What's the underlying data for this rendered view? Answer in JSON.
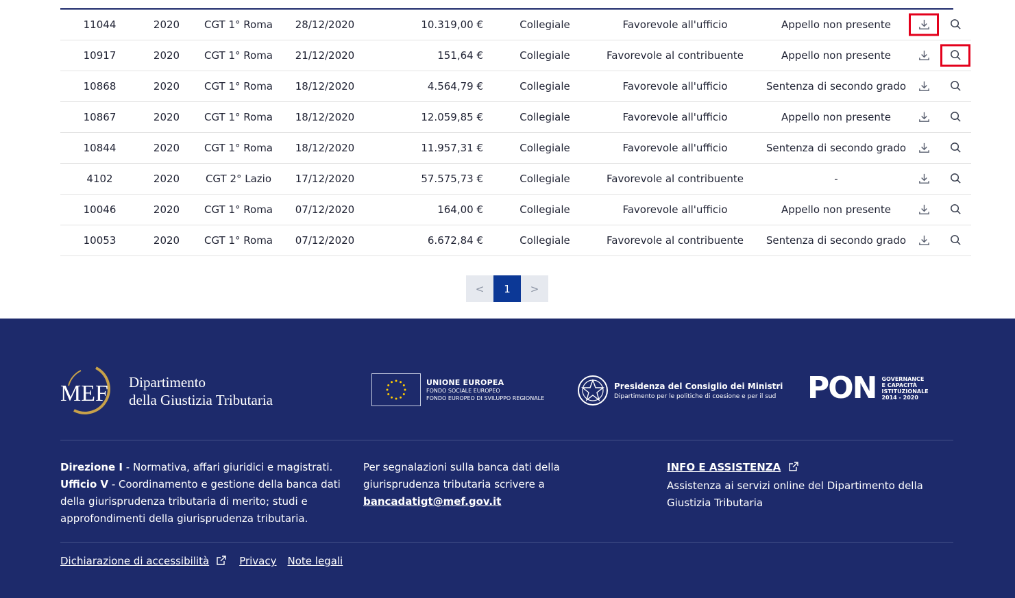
{
  "columns_count": 9,
  "rows": [
    {
      "numero": "11044",
      "anno": "2020",
      "commissione": "CGT 1° Roma",
      "data": "28/12/2020",
      "valore": "10.319,00 €",
      "composizione": "Collegiale",
      "esito": "Favorevole all'ufficio",
      "appello": "Appello non presente"
    },
    {
      "numero": "10917",
      "anno": "2020",
      "commissione": "CGT 1° Roma",
      "data": "21/12/2020",
      "valore": "151,64 €",
      "composizione": "Collegiale",
      "esito": "Favorevole al contribuente",
      "appello": "Appello non presente"
    },
    {
      "numero": "10868",
      "anno": "2020",
      "commissione": "CGT 1° Roma",
      "data": "18/12/2020",
      "valore": "4.564,79 €",
      "composizione": "Collegiale",
      "esito": "Favorevole all'ufficio",
      "appello": "Sentenza di secondo grado"
    },
    {
      "numero": "10867",
      "anno": "2020",
      "commissione": "CGT 1° Roma",
      "data": "18/12/2020",
      "valore": "12.059,85 €",
      "composizione": "Collegiale",
      "esito": "Favorevole all'ufficio",
      "appello": "Appello non presente"
    },
    {
      "numero": "10844",
      "anno": "2020",
      "commissione": "CGT 1° Roma",
      "data": "18/12/2020",
      "valore": "11.957,31 €",
      "composizione": "Collegiale",
      "esito": "Favorevole all'ufficio",
      "appello": "Sentenza di secondo grado"
    },
    {
      "numero": "4102",
      "anno": "2020",
      "commissione": "CGT 2° Lazio",
      "data": "17/12/2020",
      "valore": "57.575,73 €",
      "composizione": "Collegiale",
      "esito": "Favorevole al contribuente",
      "appello": "-"
    },
    {
      "numero": "10046",
      "anno": "2020",
      "commissione": "CGT 1° Roma",
      "data": "07/12/2020",
      "valore": "164,00 €",
      "composizione": "Collegiale",
      "esito": "Favorevole all'ufficio",
      "appello": "Appello non presente"
    },
    {
      "numero": "10053",
      "anno": "2020",
      "commissione": "CGT 1° Roma",
      "data": "07/12/2020",
      "valore": "6.672,84 €",
      "composizione": "Collegiale",
      "esito": "Favorevole al contribuente",
      "appello": "Sentenza di secondo grado"
    }
  ],
  "icons": {
    "download": "download-icon",
    "view": "search-icon"
  },
  "highlights": [
    {
      "row": 0,
      "action": "download"
    },
    {
      "row": 1,
      "action": "view"
    }
  ],
  "pagination": {
    "prev": "<",
    "current": "1",
    "next": ">"
  },
  "colors": {
    "footer_bg": "#1d2a6b",
    "accent": "#0c3896",
    "highlight": "#e3001b",
    "gold": "#c8a24a"
  },
  "footer": {
    "mef": {
      "logo_text": "MEF",
      "line1": "Dipartimento",
      "line2": "della Giustizia Tributaria"
    },
    "eu": {
      "title": "UNIONE EUROPEA",
      "line1": "FONDO SOCIALE EUROPEO",
      "line2": "FONDO EUROPEO DI SVILUPPO REGIONALE"
    },
    "pcm": {
      "title": "Presidenza del Consiglio dei Ministri",
      "subtitle": "Dipartimento per le politiche di coesione e per il sud"
    },
    "pon": {
      "word": "PON",
      "line1": "GOVERNANCE",
      "line2": "E CAPACITÀ",
      "line3": "ISTITUZIONALE",
      "line4": "2014 - 2020"
    },
    "col1": {
      "b1": "Direzione I",
      "t1": " - Normativa, affari giuridici e magistrati.",
      "b2": "Ufficio V",
      "t2": " - Coordinamento e gestione della banca dati della giurisprudenza tributaria di merito; studi e approfondimenti della giurisprudenza tributaria."
    },
    "col2": {
      "text": "Per segnalazioni sulla banca dati della giurisprudenza tributaria scrivere a ",
      "email": "bancadatigt@mef.gov.it"
    },
    "col3": {
      "title": "INFO E ASSISTENZA",
      "text": "Assistenza ai servizi online del Dipartimento della Giustizia Tributaria"
    },
    "links": {
      "accessibility": "Dichiarazione di accessibilità",
      "privacy": "Privacy",
      "legal": "Note legali"
    }
  }
}
